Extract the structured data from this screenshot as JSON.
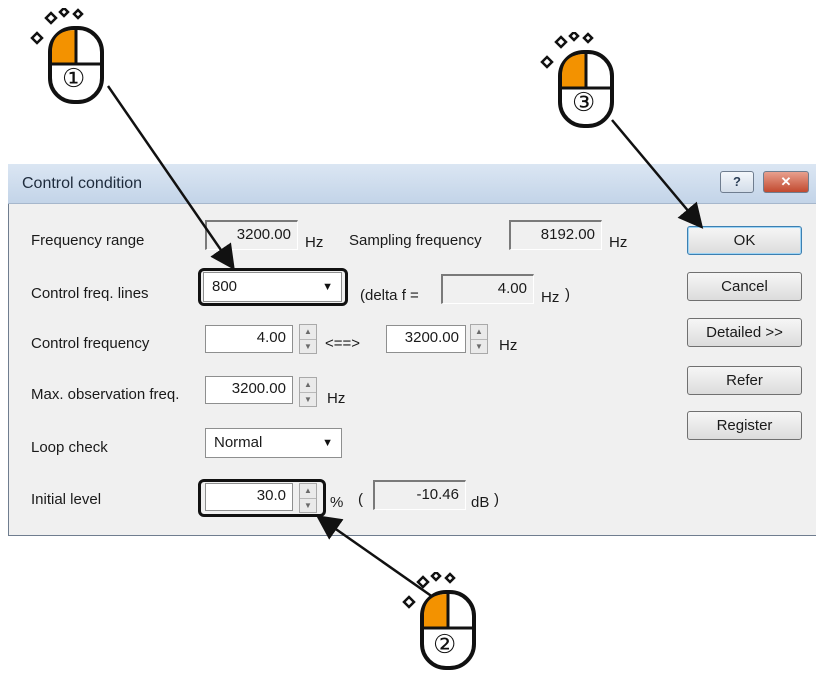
{
  "dialog": {
    "title": "Control condition",
    "help_label": "?",
    "close_label": "✕"
  },
  "rows": {
    "frequency_range": {
      "label": "Frequency range",
      "value": "3200.00",
      "unit": "Hz"
    },
    "sampling_frequency": {
      "label": "Sampling frequency",
      "value": "8192.00",
      "unit": "Hz"
    },
    "control_freq_lines": {
      "label": "Control freq. lines",
      "selected": "800"
    },
    "delta_f": {
      "prefix": "(delta f =",
      "value": "4.00",
      "unit": "Hz",
      "suffix": ")"
    },
    "control_frequency": {
      "label": "Control frequency",
      "low": "4.00",
      "sep": "<==>",
      "high": "3200.00",
      "unit": "Hz"
    },
    "max_observation_freq": {
      "label": "Max. observation freq.",
      "value": "3200.00",
      "unit": "Hz"
    },
    "loop_check": {
      "label": "Loop check",
      "selected": "Normal"
    },
    "initial_level": {
      "label": "Initial level",
      "value": "30.0",
      "unit": "%",
      "open_paren": "(",
      "db_value": "-10.46",
      "db_unit": "dB",
      "close_paren": ")"
    }
  },
  "buttons": {
    "ok": "OK",
    "cancel": "Cancel",
    "detailed": "Detailed >>",
    "refer": "Refer",
    "register": "Register"
  },
  "callouts": {
    "step1": "①",
    "step2": "②",
    "step3": "③",
    "left_button_color": "#f39200"
  },
  "icons": {
    "spin_up": "▲",
    "spin_down": "▼",
    "dropdown": "▼"
  }
}
